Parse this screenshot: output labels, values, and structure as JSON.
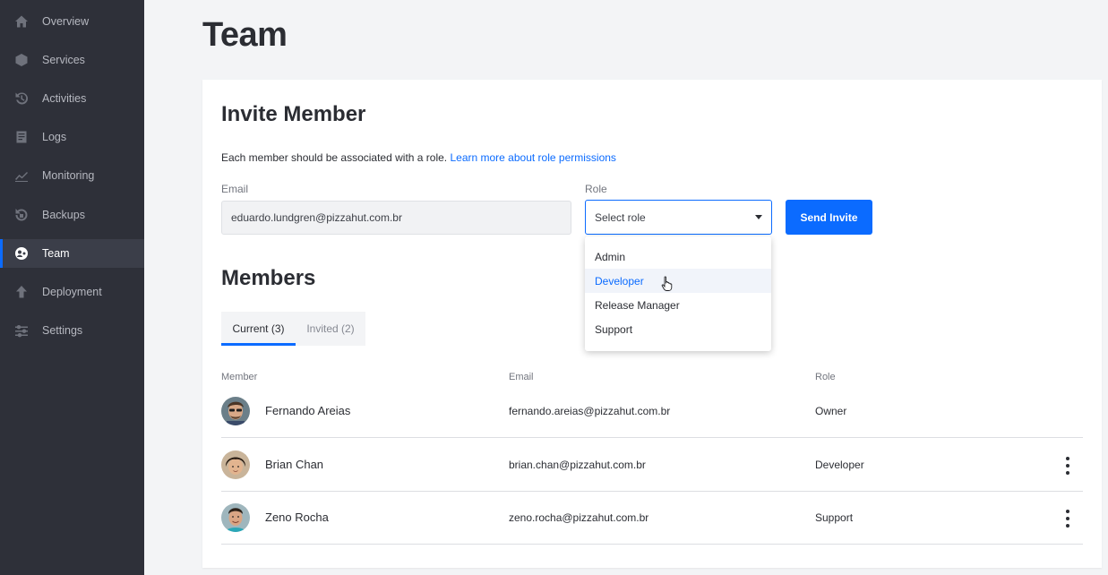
{
  "sidebar": {
    "items": [
      {
        "label": "Overview",
        "icon": "home-icon",
        "active": false
      },
      {
        "label": "Services",
        "icon": "cube-icon",
        "active": false
      },
      {
        "label": "Activities",
        "icon": "history-icon",
        "active": false
      },
      {
        "label": "Logs",
        "icon": "document-icon",
        "active": false
      },
      {
        "label": "Monitoring",
        "icon": "chart-line-icon",
        "active": false
      },
      {
        "label": "Backups",
        "icon": "backup-icon",
        "active": false
      },
      {
        "label": "Team",
        "icon": "team-icon",
        "active": true
      },
      {
        "label": "Deployment",
        "icon": "upload-icon",
        "active": false
      },
      {
        "label": "Settings",
        "icon": "sliders-icon",
        "active": false
      }
    ]
  },
  "page": {
    "title": "Team"
  },
  "invite": {
    "title": "Invite Member",
    "description": "Each member should be associated with a role.",
    "link_text": "Learn more about role permissions",
    "email_label": "Email",
    "email_value": "eduardo.lundgren@pizzahut.com.br",
    "role_label": "Role",
    "role_placeholder": "Select role",
    "send_label": "Send Invite",
    "role_options": [
      "Admin",
      "Developer",
      "Release Manager",
      "Support"
    ],
    "hovered_option": "Developer"
  },
  "members": {
    "title": "Members",
    "tabs": [
      {
        "label": "Current (3)",
        "active": true
      },
      {
        "label": "Invited (2)",
        "active": false
      }
    ],
    "columns": [
      "Member",
      "Email",
      "Role"
    ],
    "rows": [
      {
        "name": "Fernando Areias",
        "email": "fernando.areias@pizzahut.com.br",
        "role": "Owner",
        "has_menu": false
      },
      {
        "name": "Brian Chan",
        "email": "brian.chan@pizzahut.com.br",
        "role": "Developer",
        "has_menu": true
      },
      {
        "name": "Zeno Rocha",
        "email": "zeno.rocha@pizzahut.com.br",
        "role": "Support",
        "has_menu": true
      }
    ]
  },
  "colors": {
    "sidebar_bg": "#2e3039",
    "accent": "#0b6bff",
    "page_bg": "#f3f4f6"
  }
}
